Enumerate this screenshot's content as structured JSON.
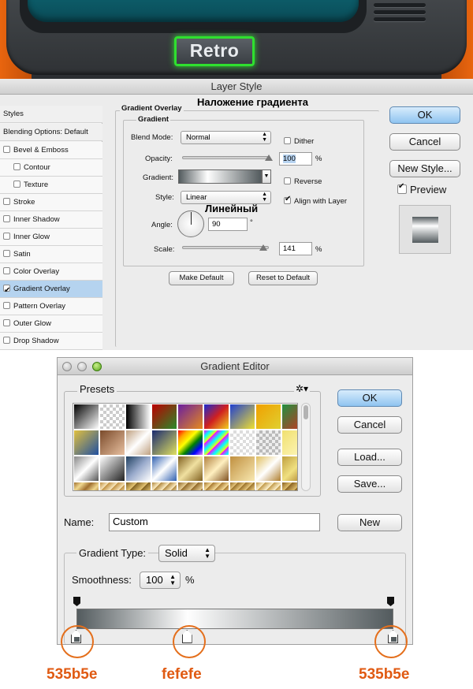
{
  "banner": {
    "retro_label": "Retro"
  },
  "layer_style": {
    "title": "Layer Style",
    "styles_header": "Styles",
    "blending_header": "Blending Options: Default",
    "items": [
      {
        "label": "Bevel & Emboss",
        "checked": false
      },
      {
        "label": "Contour",
        "checked": false,
        "indent": true
      },
      {
        "label": "Texture",
        "checked": false,
        "indent": true
      },
      {
        "label": "Stroke",
        "checked": false
      },
      {
        "label": "Inner Shadow",
        "checked": false
      },
      {
        "label": "Inner Glow",
        "checked": false
      },
      {
        "label": "Satin",
        "checked": false
      },
      {
        "label": "Color Overlay",
        "checked": false
      },
      {
        "label": "Gradient Overlay",
        "checked": true,
        "selected": true
      },
      {
        "label": "Pattern Overlay",
        "checked": false
      },
      {
        "label": "Outer Glow",
        "checked": false
      },
      {
        "label": "Drop Shadow",
        "checked": false
      }
    ],
    "section_title": "Gradient Overlay",
    "section_title_ru": "Наложение градиента",
    "group_title": "Gradient",
    "blend_mode_label": "Blend Mode:",
    "blend_mode_value": "Normal",
    "dither_label": "Dither",
    "opacity_label": "Opacity:",
    "opacity_value": "100",
    "opacity_percent": 100,
    "percent_sign": "%",
    "gradient_label": "Gradient:",
    "reverse_label": "Reverse",
    "style_label": "Style:",
    "style_value": "Linear",
    "style_value_ru": "Линейный",
    "align_label": "Align with Layer",
    "angle_label": "Angle:",
    "angle_value": "90",
    "degree_sign": "°",
    "scale_label": "Scale:",
    "scale_value": "141",
    "scale_percent": 141,
    "make_default": "Make Default",
    "reset_default": "Reset to Default",
    "ok": "OK",
    "cancel": "Cancel",
    "new_style": "New Style...",
    "preview": "Preview"
  },
  "gradient_editor": {
    "title": "Gradient Editor",
    "presets_label": "Presets",
    "gear_icon": "gear-icon",
    "ok": "OK",
    "cancel": "Cancel",
    "load": "Load...",
    "save": "Save...",
    "name_label": "Name:",
    "name_value": "Custom",
    "new_button": "New",
    "gradient_type_label": "Gradient Type:",
    "gradient_type_value": "Solid",
    "smoothness_label": "Smoothness:",
    "smoothness_value": "100",
    "percent_sign": "%",
    "stops": [
      {
        "color": "#535b5e",
        "position": 0
      },
      {
        "color": "#fefefe",
        "position": 0.35
      },
      {
        "color": "#535b5e",
        "position": 1
      }
    ]
  },
  "annotations": {
    "left_color": "535b5e",
    "mid_color": "fefefe",
    "right_color": "535b5e"
  }
}
